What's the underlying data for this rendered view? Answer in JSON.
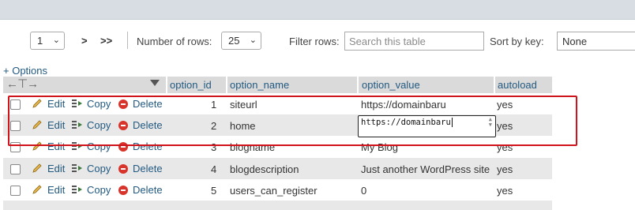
{
  "nav": {
    "page_value": "1",
    "next_label": ">",
    "last_label": ">>",
    "rows_label": "Number of rows:",
    "rows_value": "25",
    "filter_label": "Filter rows:",
    "search_placeholder": "Search this table",
    "sortkey_label": "Sort by key:",
    "sortkey_value": "None"
  },
  "options_link": "+ Options",
  "columns": [
    "option_id",
    "option_name",
    "option_value",
    "autoload"
  ],
  "actions": {
    "edit": "Edit",
    "copy": "Copy",
    "delete": "Delete"
  },
  "rows": [
    {
      "id": "1",
      "name": "siteurl",
      "value": "https://domainbaru",
      "autoload": "yes"
    },
    {
      "id": "2",
      "name": "home",
      "value": "",
      "autoload": "yes"
    },
    {
      "id": "3",
      "name": "blogname",
      "value": "My Blog",
      "autoload": "yes"
    },
    {
      "id": "4",
      "name": "blogdescription",
      "value": "Just another WordPress site",
      "autoload": "yes"
    },
    {
      "id": "5",
      "name": "users_can_register",
      "value": "0",
      "autoload": "yes"
    }
  ],
  "inline_edit_value": "https://domainbaru",
  "colors": {
    "link": "#235a81",
    "highlight": "#d0141c",
    "header": "#dadada"
  }
}
